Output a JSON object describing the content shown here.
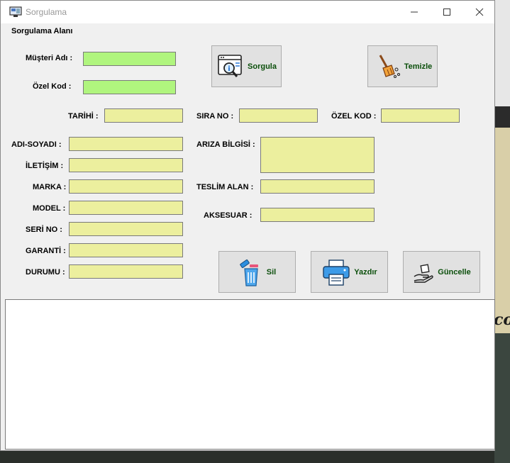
{
  "window": {
    "title": "Sorgulama"
  },
  "section": {
    "title": "Sorgulama Alanı"
  },
  "search": {
    "customer_label": "Müşteri Adı :",
    "customer_value": "",
    "code_label": "Özel Kod :",
    "code_value": "",
    "query_button": "Sorgula",
    "clear_button": "Temizle"
  },
  "info": {
    "date_label": "TARİHİ :",
    "order_label": "SIRA NO :",
    "special_code_label": "ÖZEL KOD :",
    "name_label": "ADI-SOYADI :",
    "contact_label": "İLETİŞİM :",
    "brand_label": "MARKA :",
    "model_label": "MODEL :",
    "serial_label": "SERİ NO :",
    "warranty_label": "GARANTİ :",
    "status_label": "DURUMU :",
    "fault_label": "ARIZA BİLGİSİ :",
    "receiver_label": "TESLİM ALAN :",
    "accessory_label": "AKSESUAR :"
  },
  "actions": {
    "delete": "Sil",
    "print": "Yazdır",
    "update": "Güncelle"
  },
  "icons": {
    "app": "app-window-icon",
    "query": "search-document-icon",
    "clear": "broom-icon",
    "delete": "trash-icon",
    "print": "printer-icon",
    "update": "hand-box-icon"
  },
  "background_text": "co"
}
